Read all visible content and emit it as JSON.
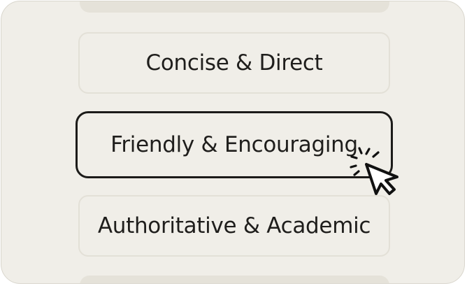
{
  "options": [
    {
      "label": "Concise & Direct",
      "selected": false
    },
    {
      "label": "Friendly & Encouraging",
      "selected": true
    },
    {
      "label": "Authoritative & Academic",
      "selected": false
    }
  ],
  "colors": {
    "panel_background": "#f0eee8",
    "option_border": "#e3e0d7",
    "selected_border": "#1c1b19",
    "text": "#1f1e1c"
  },
  "icons": {
    "cursor": "pointer-click-icon"
  }
}
